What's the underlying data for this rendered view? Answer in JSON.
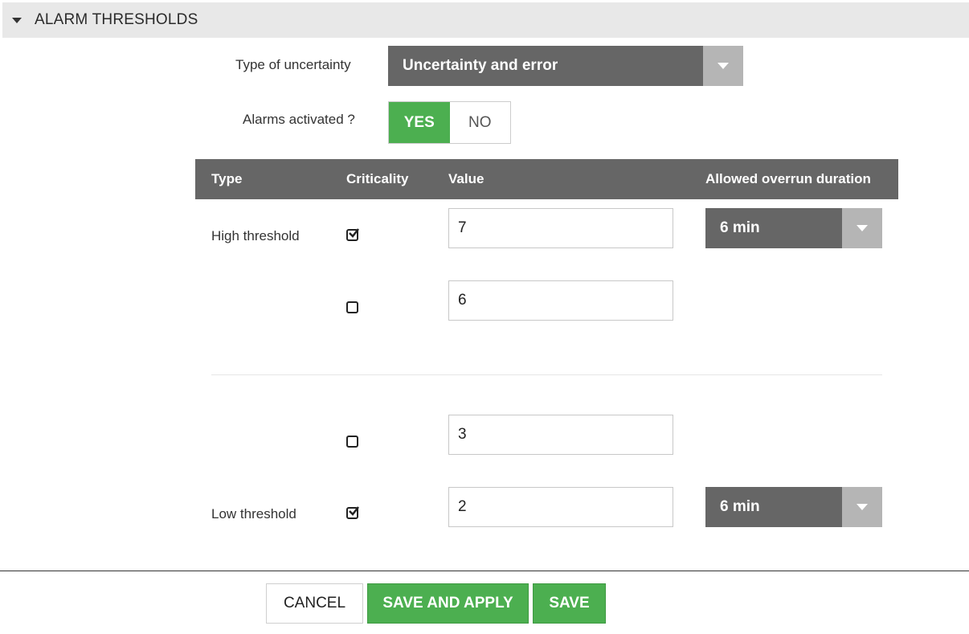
{
  "section": {
    "title": "ALARM THRESHOLDS"
  },
  "uncertainty": {
    "label": "Type of uncertainty",
    "value": "Uncertainty and error"
  },
  "alarms": {
    "label": "Alarms activated ?",
    "yes": "YES",
    "no": "NO",
    "selected": "YES"
  },
  "table": {
    "headers": [
      "Type",
      "Criticality",
      "Value",
      "Allowed overrun duration"
    ],
    "rows": [
      {
        "type": "High threshold",
        "critical": true,
        "value": "7",
        "duration": "6 min"
      },
      {
        "type": "",
        "critical": false,
        "value": "6",
        "duration": ""
      },
      {
        "type": "",
        "critical": false,
        "value": "3",
        "duration": ""
      },
      {
        "type": "Low threshold",
        "critical": true,
        "value": "2",
        "duration": "6 min"
      }
    ]
  },
  "buttons": {
    "cancel": "CANCEL",
    "save_apply": "SAVE AND APPLY",
    "save": "SAVE"
  },
  "colors": {
    "accent_green": "#4caf50",
    "dark_gray": "#666666",
    "header_bg": "#e8e8e8"
  }
}
